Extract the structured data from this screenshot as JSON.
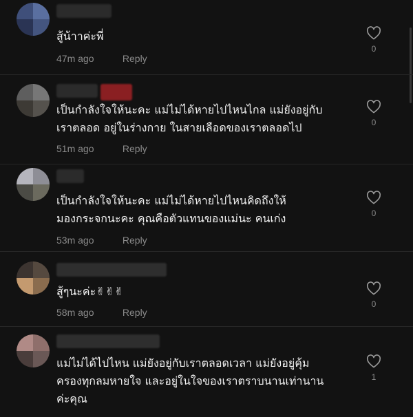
{
  "comments": [
    {
      "text": "สู้น้าาค่ะพี่",
      "time": "47m ago",
      "reply": "Reply",
      "likes": "0"
    },
    {
      "text": "เป็นกำลังใจให้นะคะ แม่ไม่ได้หายไปไหนไกล แม่ยังอยู่กับ\nเราตลอด อยู่ในร่างกาย ในสายเลือดของเราตลอดไป",
      "time": "51m ago",
      "reply": "Reply",
      "likes": "0"
    },
    {
      "text": "เป็นกำลังใจให้นะคะ แม่ไม่ได้หายไปไหนคิดถึงให้\nมองกระจกนะคะ คุณคือตัวแทนของแม่นะ คนเก่ง",
      "time": "53m ago",
      "reply": "Reply",
      "likes": "0"
    },
    {
      "text": "สู้ๆนะค่ะ✌✌✌",
      "time": "58m ago",
      "reply": "Reply",
      "likes": "0"
    },
    {
      "text": "แม่ไม่ได้ไปไหน แม่ยังอยู่กับเราตลอดเวลา แม่ยังอยู่คุ้ม\nครองทุกลมหายใจ และอยู่ในใจของเราตราบนานเท่านาน\nค่ะคุณ",
      "time": "",
      "reply": "",
      "likes": "1"
    }
  ],
  "icons": {
    "like": "heart-outline-icon"
  },
  "colors": {
    "background": "#121212",
    "text": "#f1f1f1",
    "muted": "#8a8a8a"
  }
}
